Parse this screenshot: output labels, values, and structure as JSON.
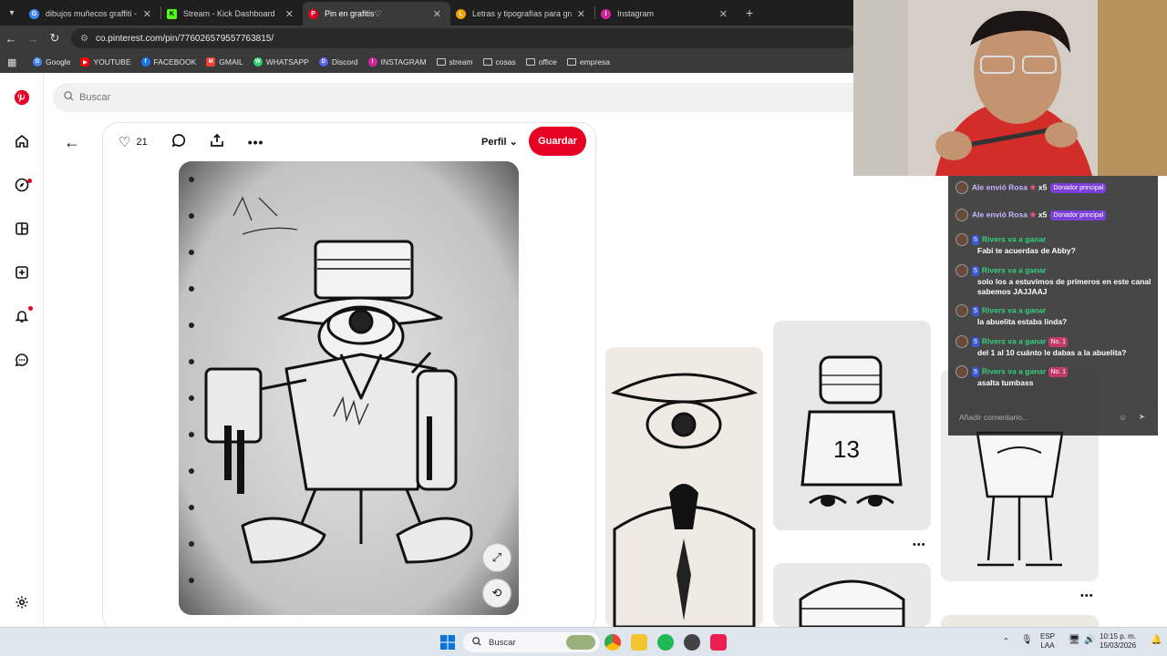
{
  "tabs": [
    {
      "title": "dibujos muñecos graffiti - Busca",
      "color": "#4285f4",
      "glyph": "G"
    },
    {
      "title": "Stream - Kick Dashboard",
      "color": "#53fc18",
      "glyph": "K"
    },
    {
      "title": "Pin en grafitis♡",
      "color": "#e60023",
      "glyph": "P"
    },
    {
      "title": "Letras y tipografías para graffiti",
      "color": "#f4a100",
      "glyph": "L"
    },
    {
      "title": "Instagram",
      "color": "#d6249f",
      "glyph": "I"
    }
  ],
  "address": {
    "url": "co.pinterest.com/pin/776026579557763815/"
  },
  "bookmarks": [
    {
      "label": "Google",
      "color": "#4285f4",
      "glyph": "G"
    },
    {
      "label": "YOUTUBE",
      "color": "#ff0000",
      "glyph": "▶"
    },
    {
      "label": "FACEBOOK",
      "color": "#1877f2",
      "glyph": "f"
    },
    {
      "label": "GMAIL",
      "color": "#ea4335",
      "glyph": "M"
    },
    {
      "label": "WHATSAPP",
      "color": "#25d366",
      "glyph": "W"
    },
    {
      "label": "Discord",
      "color": "#5865f2",
      "glyph": "D"
    },
    {
      "label": "INSTAGRAM",
      "color": "#d6249f",
      "glyph": "I"
    },
    {
      "label": "stream",
      "folder": true
    },
    {
      "label": "cosas",
      "folder": true
    },
    {
      "label": "office",
      "folder": true
    },
    {
      "label": "empresa",
      "folder": true
    }
  ],
  "pinterest": {
    "search_placeholder": "Buscar",
    "likes": "21",
    "profile_label": "Perfil",
    "save_label": "Guardar",
    "accent": "#e60023"
  },
  "chat": {
    "messages": [
      {
        "user": "Ale",
        "text": "envió Rosa",
        "mult": "x5",
        "badge": "Donador principal",
        "type": "gift"
      },
      {
        "user": "Ale",
        "text": "envió Rosa",
        "mult": "x5",
        "badge": "Donador principal",
        "type": "gift"
      },
      {
        "user": "Rivers va a ganar",
        "level": "5",
        "text": "Fabi te acuerdas de Abby?",
        "type": "msg"
      },
      {
        "user": "Rivers va a ganar",
        "level": "5",
        "text": "solo los a estuvimos de primeros en este canal sabemos JAJJAAJ",
        "type": "msg"
      },
      {
        "user": "Rivers va a ganar",
        "level": "5",
        "text": "la abuelita estaba linda?",
        "type": "msg"
      },
      {
        "user": "Rivers va a ganar",
        "level": "5",
        "rank": "No. 1",
        "text": "del 1 al 10 cuánto le dabas a la abuelita?",
        "type": "msg"
      },
      {
        "user": "Rivers va a ganar",
        "level": "5",
        "rank": "No. 1",
        "text": "asalta tumbass",
        "type": "msg"
      }
    ],
    "input_placeholder": "Añadir comentario..."
  },
  "taskbar": {
    "search_label": "Buscar",
    "lang": "ESP",
    "lang2": "LAA",
    "time": "10:15 p. m.",
    "date": "15/03/2026"
  }
}
